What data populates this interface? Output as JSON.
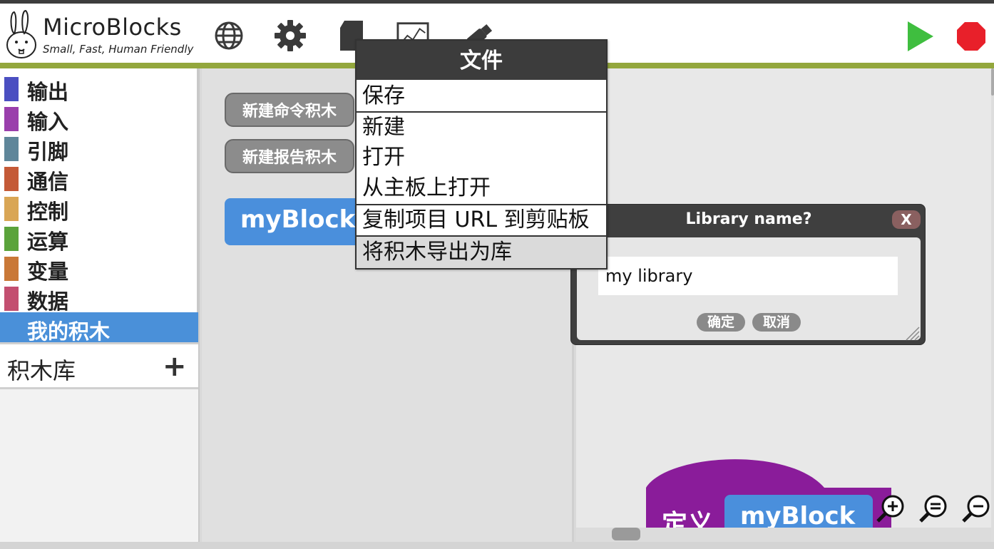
{
  "app": {
    "title": "MicroBlocks",
    "subtitle": "Small, Fast, Human Friendly"
  },
  "toolbar": {
    "icons": [
      "globe-icon",
      "gear-icon",
      "file-icon",
      "graph-icon",
      "usb-icon"
    ],
    "run_icon": "play-icon",
    "stop_icon": "stop-icon",
    "run_color": "#3fbe3f",
    "stop_color": "#e8202a"
  },
  "categories": [
    {
      "label": "输出",
      "color": "#4b4fc1"
    },
    {
      "label": "输入",
      "color": "#9a3fac"
    },
    {
      "label": "引脚",
      "color": "#5f869a"
    },
    {
      "label": "通信",
      "color": "#c45a37"
    },
    {
      "label": "控制",
      "color": "#d9a655"
    },
    {
      "label": "运算",
      "color": "#5ba33b"
    },
    {
      "label": "变量",
      "color": "#c97837"
    },
    {
      "label": "数据",
      "color": "#c34f70"
    },
    {
      "label": "我的积木",
      "color": "#4a90d9",
      "selected": true
    }
  ],
  "libraries": {
    "label": "积木库",
    "add": "+"
  },
  "blocks_panel": {
    "new_command": "新建命令积木",
    "new_reporter": "新建报告积木",
    "block_name": "myBlock"
  },
  "file_menu": {
    "title": "文件",
    "items": [
      "保存",
      "新建",
      "打开",
      "从主板上打开",
      "复制项目 URL 到剪贴板",
      "将积木导出为库"
    ],
    "highlighted": "将积木导出为库"
  },
  "dialog": {
    "title": "Library name?",
    "close": "X",
    "input_value": "my library",
    "ok": "确定",
    "cancel": "取消"
  },
  "script": {
    "define_label": "定义",
    "block_name": "myBlock",
    "hat_color": "#8a1c9a"
  },
  "zoom": [
    "zoom-in-icon",
    "zoom-reset-icon",
    "zoom-out-icon"
  ]
}
